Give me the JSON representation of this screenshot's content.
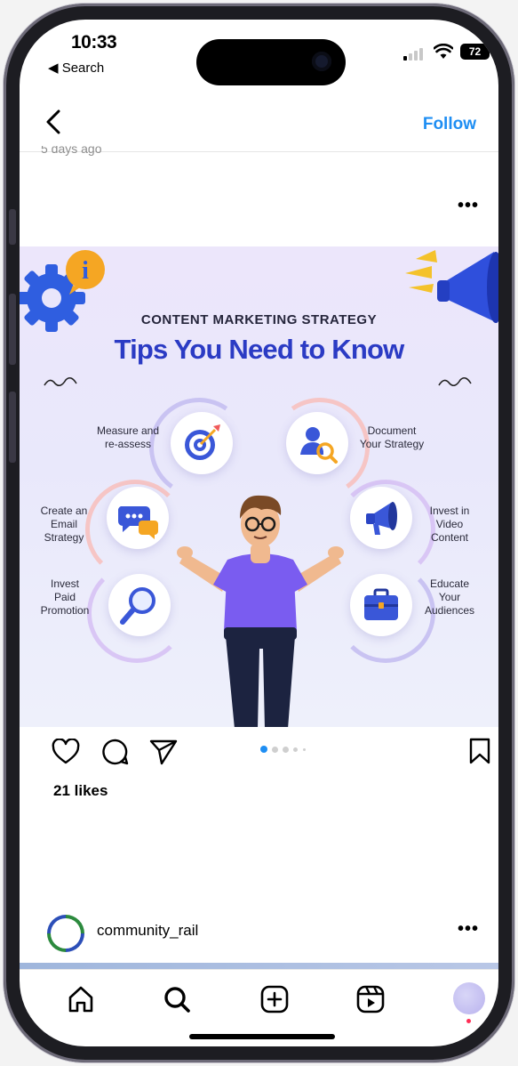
{
  "status_bar": {
    "time": "10:33",
    "back_app": "◀ Search",
    "battery": "72"
  },
  "header": {
    "follow_label": "Follow",
    "post_age": "5 days ago"
  },
  "post": {
    "subtitle": "CONTENT MARKETING STRATEGY",
    "title": "Tips You Need to Know",
    "tips": {
      "measure": "Measure and\nre-assess",
      "document": "Document\nYour Strategy",
      "email": "Create an\nEmail\nStrategy",
      "video": "Invest in\nVideo\nContent",
      "paid": "Invest\nPaid\nPromotion",
      "educate": "Educate\nYour\nAudiences"
    },
    "carousel_count": 5,
    "carousel_active": 1
  },
  "engagement": {
    "likes": "21 likes"
  },
  "next_post": {
    "username": "community_rail"
  },
  "tab_bar": {
    "items": [
      "home-icon",
      "search-icon",
      "create-icon",
      "reels-icon",
      "profile-avatar"
    ]
  },
  "colors": {
    "accent": "#1e8ef3",
    "title_blue": "#2b3bc4",
    "notification_dot": "#ff2d55"
  }
}
